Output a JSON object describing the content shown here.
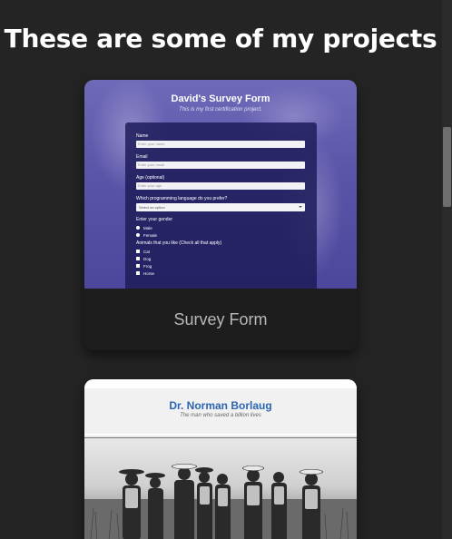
{
  "section": {
    "title": "These are some of my projects"
  },
  "projects": [
    {
      "label": "Survey Form",
      "preview": {
        "title": "David's Survey Form",
        "description": "This is my first certification project.",
        "fields": [
          {
            "label": "Name",
            "placeholder": "Enter your name"
          },
          {
            "label": "Email",
            "placeholder": "Enter your email"
          },
          {
            "label": "Age (optional)",
            "placeholder": "Enter your age"
          }
        ],
        "select": {
          "label": "Which programming language do you prefer?",
          "value": "Select an option"
        },
        "gender": {
          "label": "Enter your gender",
          "options": [
            "Male",
            "Female"
          ]
        },
        "animals": {
          "label": "Animals that you like (Check all that apply)",
          "options": [
            "Cat",
            "Dog",
            "Frog",
            "Horse"
          ]
        }
      }
    },
    {
      "label": "",
      "preview": {
        "title": "Dr. Norman Borlaug",
        "subtitle": "The man who saved a billion lives"
      }
    }
  ],
  "colors": {
    "background": "#242424",
    "title_text": "#ffffff",
    "card_label_text": "#b8b8b8",
    "survey_accent": "#5a55a8",
    "borlaug_title": "#2a66b0"
  },
  "icons": {
    "radio": "radio-icon",
    "checkbox": "checkbox-icon"
  }
}
